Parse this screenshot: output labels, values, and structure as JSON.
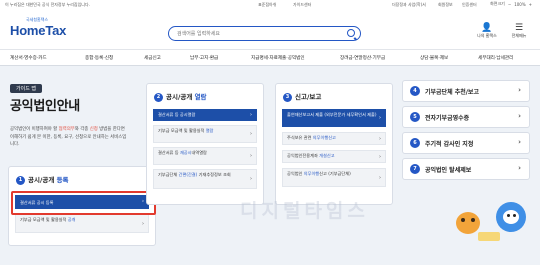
{
  "topbar": {
    "gov_notice": "이 누리집은 대한민국 공식 전자정부 누리집입니다.",
    "util_1": "표준점아쉬",
    "util_2": "가이드센터",
    "links": [
      "더장정과 사업(학)서",
      "회원정보",
      "회원정보/로그아웃",
      "인증센터",
      "개인 정보"
    ],
    "font_label": "화면크기",
    "zoom": "100%"
  },
  "header": {
    "logo_sub": "국세청홈택스",
    "logo_main": "HomeTax",
    "search_placeholder": "검색어를 입력하세요",
    "icons": [
      {
        "name": "my-hometax",
        "label": "나의 홈택스",
        "glyph": "👤"
      },
      {
        "name": "all-menu",
        "label": "전체메뉴",
        "glyph": "☰"
      }
    ]
  },
  "nav": {
    "items": [
      "계산서·영수증·카드",
      "종합·등록·신청",
      "세금신고",
      "납부·고지·환급",
      "지급명세·자료제출·공익법인",
      "장려금·연말정산·기부금",
      "상담·불복·제보",
      "세무대리·납세관리"
    ]
  },
  "main": {
    "badge": "가이드 맵",
    "title": "공익법인안내",
    "intro_parts": [
      "공익법인이 이행하여야 할 ",
      "협력의무",
      "와 각종 ",
      "신청",
      " 방법을 한다면 이해하기 쉽게 본 이한, 등록, 요구, 선청으로 안내하는 서비스입니다."
    ]
  },
  "sections": {
    "s1": {
      "num": "1",
      "title": "공시/공개 ",
      "title_hl": "등록",
      "items": [
        {
          "text": "결산서류 공시 등록",
          "active": true
        },
        {
          "text": "기부금 모금액 및 활용실적 ",
          "hl": "공개"
        }
      ]
    },
    "s2": {
      "num": "2",
      "title": "공시/공개 ",
      "title_hl": "열람",
      "items": [
        {
          "text": "결산서류 등 공시열람",
          "active": true
        },
        {
          "text": "기부금 모금액 및 활용실적 ",
          "hl": "열람"
        },
        {
          "text": "결산서류 등 ",
          "hl": "재공시",
          "tail": "내역열람"
        },
        {
          "text": "기부금단체 ",
          "hl": "간편(간결)",
          "tail": " 기재추정정보 조회"
        }
      ]
    },
    "s3": {
      "num": "3",
      "title": "신고/보고",
      "items": [
        {
          "text": "출연재산보고서 제출 (외부전문가 세무확인서 제출)",
          "active": true
        },
        {
          "text": "주식보유 관련 ",
          "hl": "의무이행신고"
        },
        {
          "text": "공익법인전용계좌 ",
          "hl": "개설신고"
        },
        {
          "text": "공익법인 ",
          "hl": "의무이행",
          "tail": "신고 (기부금단체)"
        }
      ]
    },
    "right": [
      {
        "num": "4",
        "label": "기부금단체 추천/보고"
      },
      {
        "num": "5",
        "label": "전자기부금영수증"
      },
      {
        "num": "6",
        "label": "주기적 감사인 지정"
      },
      {
        "num": "7",
        "label": "공익법인 탈세제보"
      }
    ]
  },
  "watermark": "디지털타임스",
  "colors": {
    "brand": "#1d4fa8",
    "accent": "#2457c5",
    "highlight": "#e23a2e",
    "background": "#eef2f7"
  }
}
